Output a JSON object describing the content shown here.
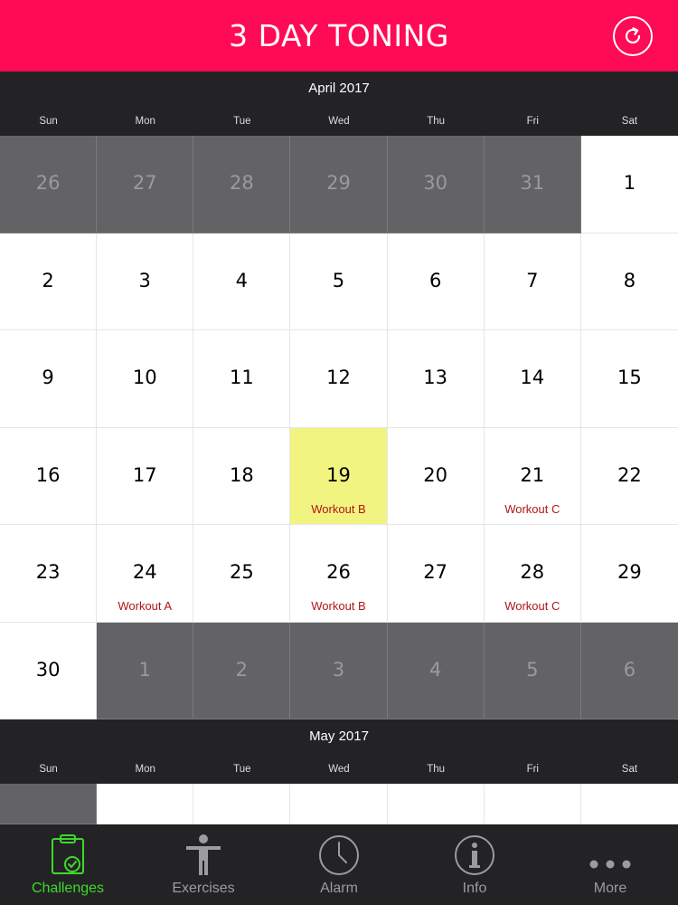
{
  "header": {
    "title": "3 DAY TONING",
    "refresh_icon": "refresh-icon"
  },
  "colors": {
    "accent": "#ff0a54",
    "active_tab": "#3ed92a",
    "workout_label": "#b01616",
    "today": "#f2f481"
  },
  "april": {
    "title": "April 2017",
    "weekdays": [
      "Sun",
      "Mon",
      "Tue",
      "Wed",
      "Thu",
      "Fri",
      "Sat"
    ],
    "weeks": [
      [
        {
          "day": "26",
          "other": true
        },
        {
          "day": "27",
          "other": true
        },
        {
          "day": "28",
          "other": true
        },
        {
          "day": "29",
          "other": true
        },
        {
          "day": "30",
          "other": true
        },
        {
          "day": "31",
          "other": true
        },
        {
          "day": "1"
        }
      ],
      [
        {
          "day": "2"
        },
        {
          "day": "3"
        },
        {
          "day": "4"
        },
        {
          "day": "5"
        },
        {
          "day": "6"
        },
        {
          "day": "7"
        },
        {
          "day": "8"
        }
      ],
      [
        {
          "day": "9"
        },
        {
          "day": "10"
        },
        {
          "day": "11"
        },
        {
          "day": "12"
        },
        {
          "day": "13"
        },
        {
          "day": "14"
        },
        {
          "day": "15"
        }
      ],
      [
        {
          "day": "16"
        },
        {
          "day": "17"
        },
        {
          "day": "18"
        },
        {
          "day": "19",
          "today": true,
          "label": "Workout B"
        },
        {
          "day": "20"
        },
        {
          "day": "21",
          "label": "Workout C"
        },
        {
          "day": "22"
        }
      ],
      [
        {
          "day": "23"
        },
        {
          "day": "24",
          "label": "Workout A"
        },
        {
          "day": "25"
        },
        {
          "day": "26",
          "label": "Workout B"
        },
        {
          "day": "27"
        },
        {
          "day": "28",
          "label": "Workout C"
        },
        {
          "day": "29"
        }
      ],
      [
        {
          "day": "30"
        },
        {
          "day": "1",
          "other": true
        },
        {
          "day": "2",
          "other": true
        },
        {
          "day": "3",
          "other": true
        },
        {
          "day": "4",
          "other": true
        },
        {
          "day": "5",
          "other": true
        },
        {
          "day": "6",
          "other": true
        }
      ]
    ]
  },
  "may": {
    "title": "May 2017",
    "weekdays": [
      "Sun",
      "Mon",
      "Tue",
      "Wed",
      "Thu",
      "Fri",
      "Sat"
    ],
    "weeks": [
      [
        {
          "day": "",
          "other": true
        },
        {
          "day": ""
        },
        {
          "day": ""
        },
        {
          "day": ""
        },
        {
          "day": ""
        },
        {
          "day": ""
        },
        {
          "day": ""
        }
      ]
    ]
  },
  "tabs": [
    {
      "label": "Challenges",
      "icon": "clipboard-check-icon",
      "active": true
    },
    {
      "label": "Exercises",
      "icon": "person-icon",
      "active": false
    },
    {
      "label": "Alarm",
      "icon": "clock-icon",
      "active": false
    },
    {
      "label": "Info",
      "icon": "info-icon",
      "active": false
    },
    {
      "label": "More",
      "icon": "more-dots-icon",
      "active": false
    }
  ]
}
